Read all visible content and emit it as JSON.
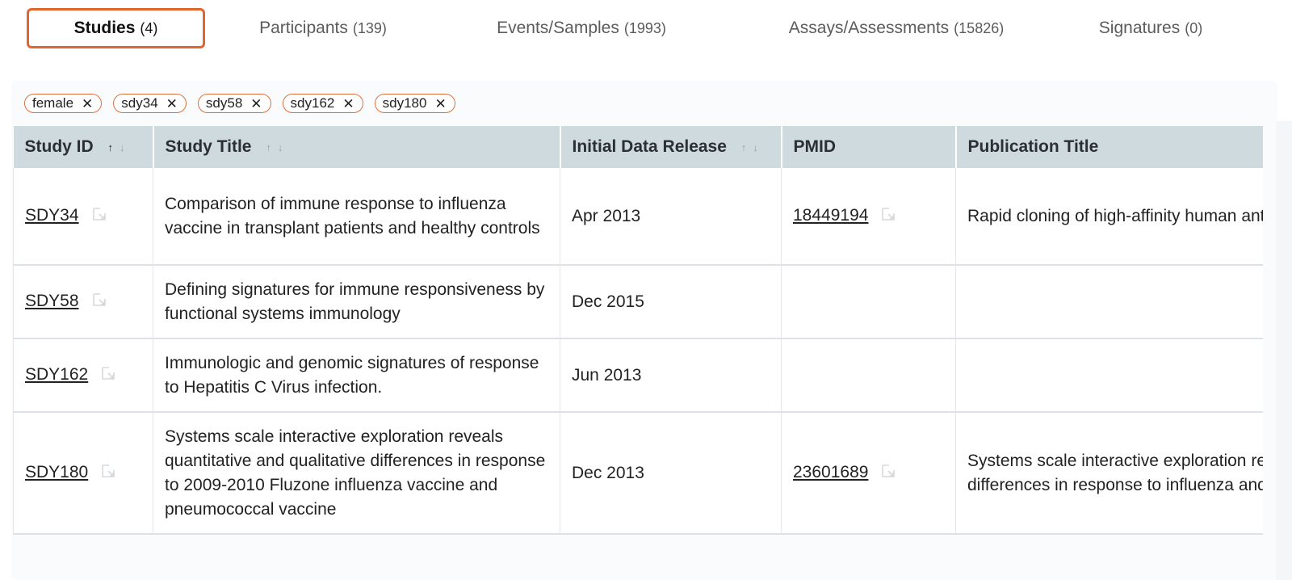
{
  "tabs": [
    {
      "label": "Studies",
      "count": "(4)"
    },
    {
      "label": "Participants",
      "count": "(139)"
    },
    {
      "label": "Events/Samples",
      "count": "(1993)"
    },
    {
      "label": "Assays/Assessments",
      "count": "(15826)"
    },
    {
      "label": "Signatures",
      "count": "(0)"
    }
  ],
  "active_tab": "Studies",
  "filters": [
    {
      "label": "female",
      "remove": "✕"
    },
    {
      "label": "sdy34",
      "remove": "✕"
    },
    {
      "label": "sdy58",
      "remove": "✕"
    },
    {
      "label": "sdy162",
      "remove": "✕"
    },
    {
      "label": "sdy180",
      "remove": "✕"
    }
  ],
  "table": {
    "columns": [
      {
        "label": "Study ID",
        "sortable": true
      },
      {
        "label": "Study Title",
        "sortable": true
      },
      {
        "label": "Initial Data Release",
        "sortable": true
      },
      {
        "label": "PMID",
        "sortable": false
      },
      {
        "label": "Publication Title",
        "sortable": false
      }
    ],
    "sort_up": "↑",
    "sort_down": "↓",
    "rows": [
      {
        "study_id": "SDY34",
        "study_title": "Comparison of immune response to influenza vaccine in transplant patients and healthy controls",
        "release": "Apr 2013",
        "pmid": "18449194",
        "pub_title": "Rapid cloning of high-affinity human antibodies against influenza virus."
      },
      {
        "study_id": "SDY58",
        "study_title": "Defining signatures for immune responsiveness by functional systems immunology",
        "release": "Dec 2015",
        "pmid": "",
        "pub_title": ""
      },
      {
        "study_id": "SDY162",
        "study_title": "Immunologic and genomic signatures of response to Hepatitis C Virus infection.",
        "release": "Jun 2013",
        "pmid": "",
        "pub_title": ""
      },
      {
        "study_id": "SDY180",
        "study_title": "Systems scale interactive exploration reveals quantitative and qualitative differences in response to 2009-2010 Fluzone influenza vaccine and pneumococcal vaccine",
        "release": "Dec 2013",
        "pmid": "23601689",
        "pub_title": "Systems scale interactive exploration reveals quantitative and qualitative differences in response to influenza and pneumococcal vaccines"
      }
    ]
  },
  "colors": {
    "accent": "#e0662e",
    "header_bg": "#cfdadf"
  }
}
